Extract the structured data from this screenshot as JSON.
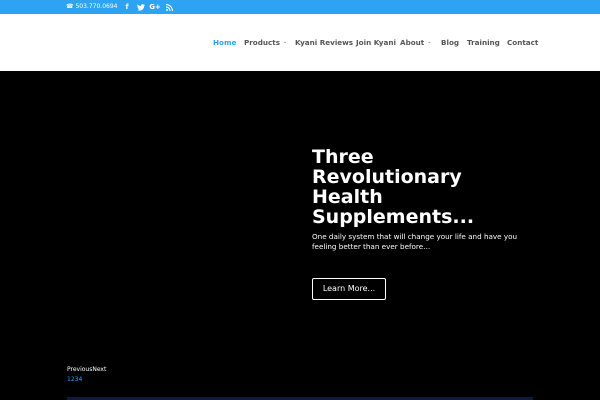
{
  "topbar": {
    "phone_icon": "phone-icon",
    "phone": "503.770.0694",
    "social": [
      {
        "name": "facebook-icon",
        "glyph": "f"
      },
      {
        "name": "twitter-icon",
        "glyph": ""
      },
      {
        "name": "google-plus-icon",
        "glyph": "G+"
      },
      {
        "name": "rss-icon",
        "glyph": ""
      }
    ],
    "bg_color": "#2ea3f2"
  },
  "nav": {
    "items": [
      {
        "label": "Home",
        "active": true
      },
      {
        "label": "Products",
        "dropdown": true
      },
      {
        "label": "Kyani Reviews"
      },
      {
        "label": "Join Kyani"
      },
      {
        "label": "About",
        "dropdown": true
      },
      {
        "label": "Blog"
      },
      {
        "label": "Training"
      },
      {
        "label": "Contact"
      }
    ],
    "chevron": "⌄",
    "accent": "#2ea3f2"
  },
  "hero": {
    "title_lines": [
      "Three",
      "Revolutionary",
      "Health",
      "Supplements..."
    ],
    "subtitle": "One daily system that will change your life and have you feeling better than ever before…",
    "button": "Learn More..."
  },
  "slider": {
    "prev": "Previous",
    "next": "Next",
    "dots": [
      "1",
      "2",
      "3",
      "4"
    ]
  }
}
